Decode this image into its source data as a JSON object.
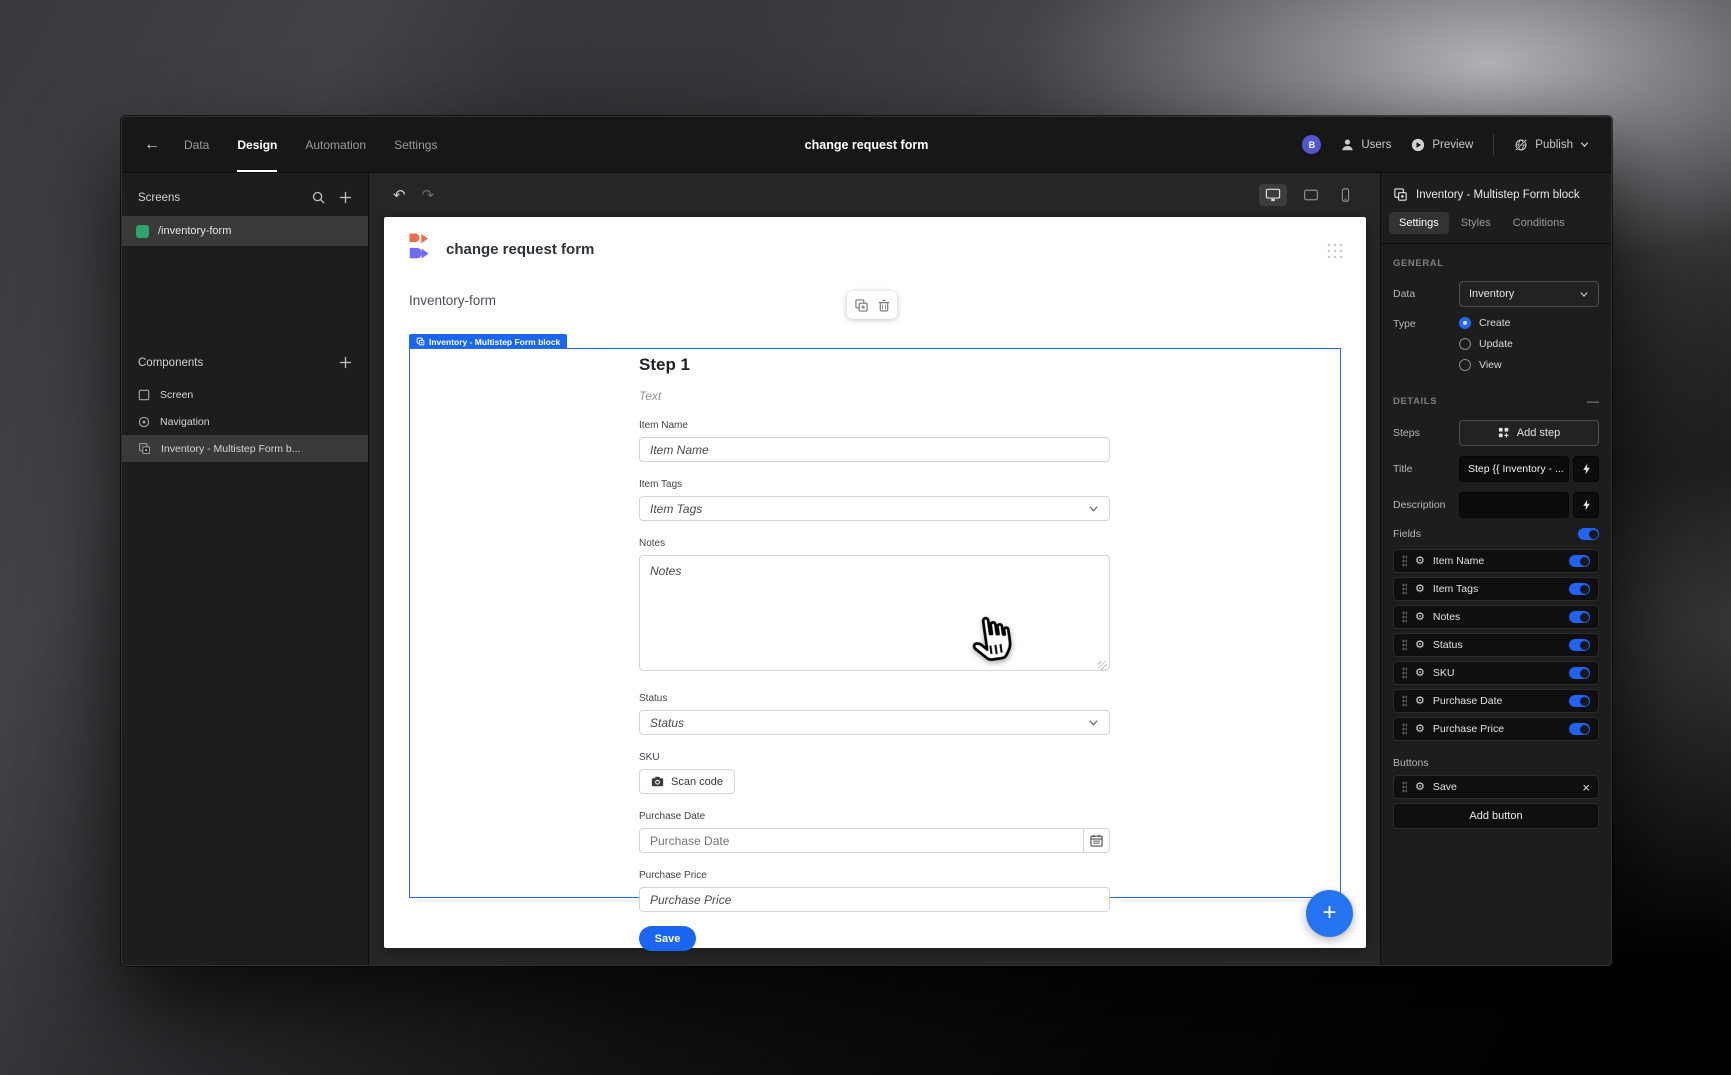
{
  "top_nav": {
    "tabs": [
      {
        "label": "Data",
        "active": false
      },
      {
        "label": "Design",
        "active": true
      },
      {
        "label": "Automation",
        "active": false
      },
      {
        "label": "Settings",
        "active": false
      }
    ],
    "title": "change request form",
    "avatar_initial": "B",
    "users_label": "Users",
    "preview_label": "Preview",
    "publish_label": "Publish"
  },
  "left_sidebar": {
    "screens_header": "Screens",
    "screens": [
      {
        "label": "/inventory-form",
        "selected": true
      }
    ],
    "components_header": "Components",
    "components": [
      {
        "label": "Screen",
        "selected": false
      },
      {
        "label": "Navigation",
        "selected": false
      },
      {
        "label": "Inventory - Multistep Form b...",
        "selected": true
      }
    ]
  },
  "canvas": {
    "page_title": "change request form",
    "form_name": "Inventory-form",
    "selection_tag": "Inventory - Multistep Form block",
    "step_title": "Step 1",
    "step_subtitle": "Text",
    "fields": [
      {
        "label": "Item Name",
        "placeholder": "Item Name",
        "type": "text"
      },
      {
        "label": "Item Tags",
        "placeholder": "Item Tags",
        "type": "select"
      },
      {
        "label": "Notes",
        "placeholder": "Notes",
        "type": "textarea"
      },
      {
        "label": "Status",
        "placeholder": "Status",
        "type": "select"
      },
      {
        "label": "SKU",
        "button": "Scan code",
        "type": "scan"
      },
      {
        "label": "Purchase Date",
        "placeholder": "Purchase Date",
        "type": "date"
      },
      {
        "label": "Purchase Price",
        "placeholder": "Purchase Price",
        "type": "text"
      }
    ],
    "save_button": "Save"
  },
  "right_panel": {
    "header": "Inventory - Multistep Form block",
    "tabs": [
      {
        "label": "Settings",
        "active": true
      },
      {
        "label": "Styles",
        "active": false
      },
      {
        "label": "Conditions",
        "active": false
      }
    ],
    "general": {
      "section": "GENERAL",
      "data_label": "Data",
      "data_value": "Inventory",
      "type_label": "Type",
      "type_options": [
        {
          "label": "Create",
          "selected": true
        },
        {
          "label": "Update",
          "selected": false
        },
        {
          "label": "View",
          "selected": false
        }
      ]
    },
    "details": {
      "section": "DETAILS",
      "steps_label": "Steps",
      "add_step_label": "Add step",
      "title_label": "Title",
      "title_value": "Step {{ Inventory - ...",
      "description_label": "Description",
      "description_value": "",
      "fields_label": "Fields",
      "fields_toggle_on": true,
      "fields": [
        {
          "label": "Item Name",
          "enabled": true
        },
        {
          "label": "Item Tags",
          "enabled": true
        },
        {
          "label": "Notes",
          "enabled": true
        },
        {
          "label": "Status",
          "enabled": true
        },
        {
          "label": "SKU",
          "enabled": true
        },
        {
          "label": "Purchase Date",
          "enabled": true
        },
        {
          "label": "Purchase Price",
          "enabled": true
        }
      ],
      "buttons_label": "Buttons",
      "buttons": [
        {
          "label": "Save"
        }
      ],
      "add_button_label": "Add button"
    }
  },
  "colors": {
    "accent_blue": "#1a66f0",
    "selection_blue": "#2a6ef5",
    "logo_orange": "#ed6c4d",
    "logo_purple": "#6f6cf2",
    "screen_icon_green": "#2fa36b",
    "avatar_bg": "#5157cd"
  }
}
